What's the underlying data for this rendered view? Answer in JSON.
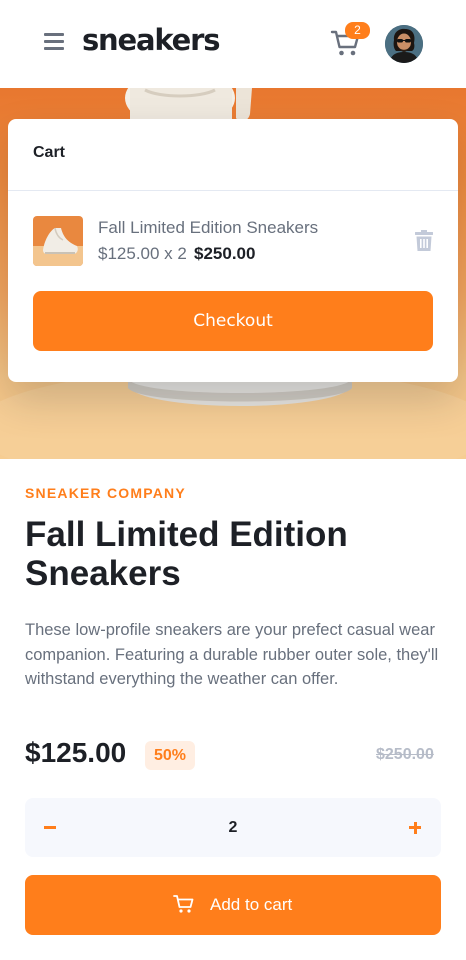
{
  "header": {
    "logo": "sneakers",
    "cart_count": "2"
  },
  "cart": {
    "title": "Cart",
    "item": {
      "name": "Fall Limited Edition Sneakers",
      "calc": "$125.00 x 2",
      "total": "$250.00"
    },
    "checkout_label": "Checkout"
  },
  "product": {
    "company": "SNEAKER COMPANY",
    "title": "Fall Limited Edition Sneakers",
    "description": "These low-profile sneakers are your prefect casual wear companion. Featuring a durable rubber outer sole, they'll withstand everything the weather can offer.",
    "price": "$125.00",
    "discount": "50%",
    "old_price": "$250.00",
    "quantity": "2",
    "add_label": "Add to cart"
  },
  "colors": {
    "accent": "#ff7e1b",
    "accent_pale": "#ffeee2",
    "dark": "#1d2026",
    "grey": "#68707d"
  }
}
